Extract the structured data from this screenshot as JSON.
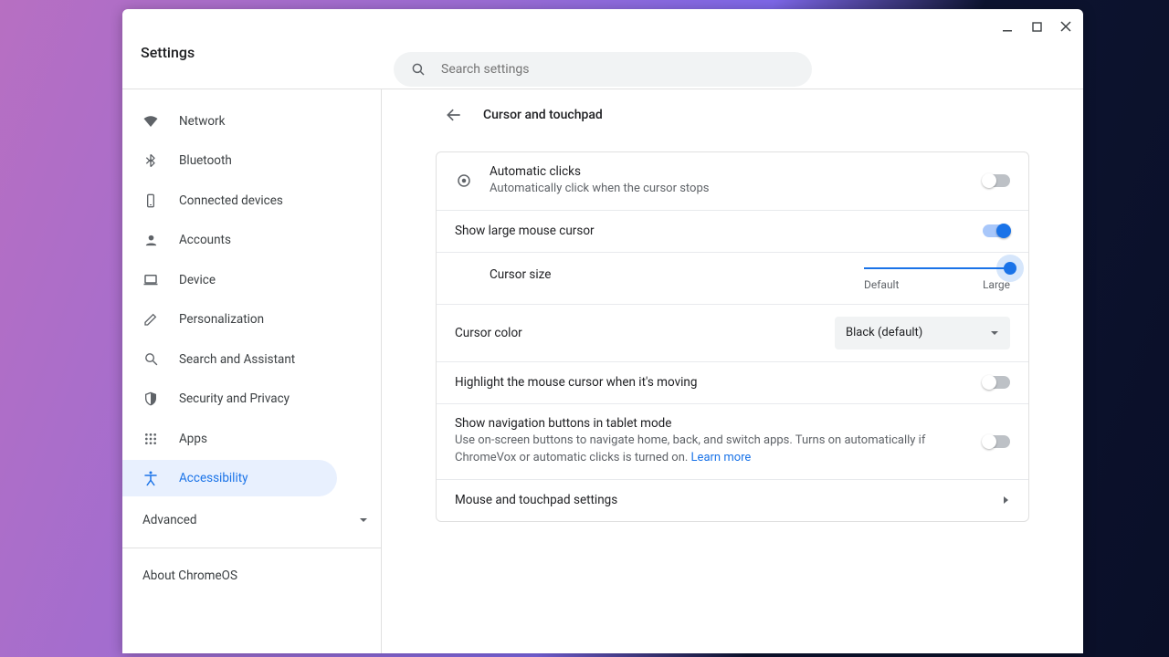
{
  "app": {
    "title": "Settings"
  },
  "search": {
    "placeholder": "Search settings"
  },
  "sidebar": {
    "items": [
      {
        "label": "Network"
      },
      {
        "label": "Bluetooth"
      },
      {
        "label": "Connected devices"
      },
      {
        "label": "Accounts"
      },
      {
        "label": "Device"
      },
      {
        "label": "Personalization"
      },
      {
        "label": "Search and Assistant"
      },
      {
        "label": "Security and Privacy"
      },
      {
        "label": "Apps"
      },
      {
        "label": "Accessibility"
      }
    ],
    "advanced": "Advanced",
    "about": "About ChromeOS"
  },
  "page": {
    "title": "Cursor and touchpad",
    "autoclick_title": "Automatic clicks",
    "autoclick_sub": "Automatically click when the cursor stops",
    "large_cursor": "Show large mouse cursor",
    "cursor_size": "Cursor size",
    "slider_left": "Default",
    "slider_right": "Large",
    "cursor_color": "Cursor color",
    "color_value": "Black (default)",
    "highlight": "Highlight the mouse cursor when it's moving",
    "tablet_title": "Show navigation buttons in tablet mode",
    "tablet_sub": "Use on-screen buttons to navigate home, back, and switch apps. Turns on automatically if ChromeVox or automatic clicks is turned on. ",
    "learn_more": "Learn more",
    "mouse_settings": "Mouse and touchpad settings"
  },
  "toggles": {
    "autoclick": false,
    "large_cursor": true,
    "highlight": false,
    "tablet": false
  },
  "colors": {
    "accent": "#1a73e8"
  }
}
